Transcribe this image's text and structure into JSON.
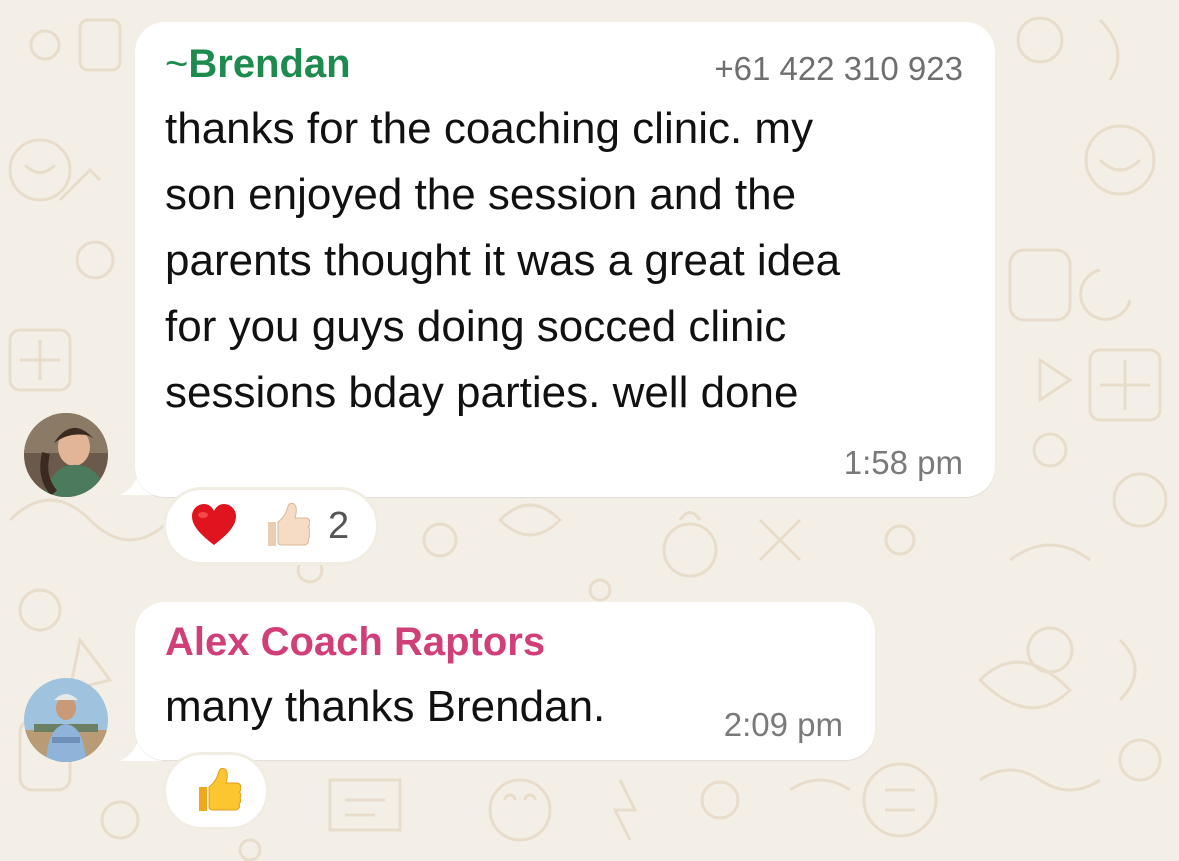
{
  "messages": [
    {
      "sender_prefix": "~",
      "sender": "Brendan",
      "phone": "+61 422 310 923",
      "text": "thanks for the coaching clinic. my\nson enjoyed the session and the\nparents thought it was a great idea\nfor you guys doing socced clinic\nsessions bday parties. well done",
      "time": "1:58 pm",
      "sender_color": "#1d8a4e",
      "reactions": [
        "heart-emoji",
        "thumbs-up-light-emoji"
      ],
      "reaction_count": "2"
    },
    {
      "sender": "Alex Coach Raptors",
      "text": "many thanks Brendan.",
      "time": "2:09 pm",
      "sender_color": "#d13f78",
      "reactions": [
        "thumbs-up-yellow-emoji"
      ]
    }
  ]
}
